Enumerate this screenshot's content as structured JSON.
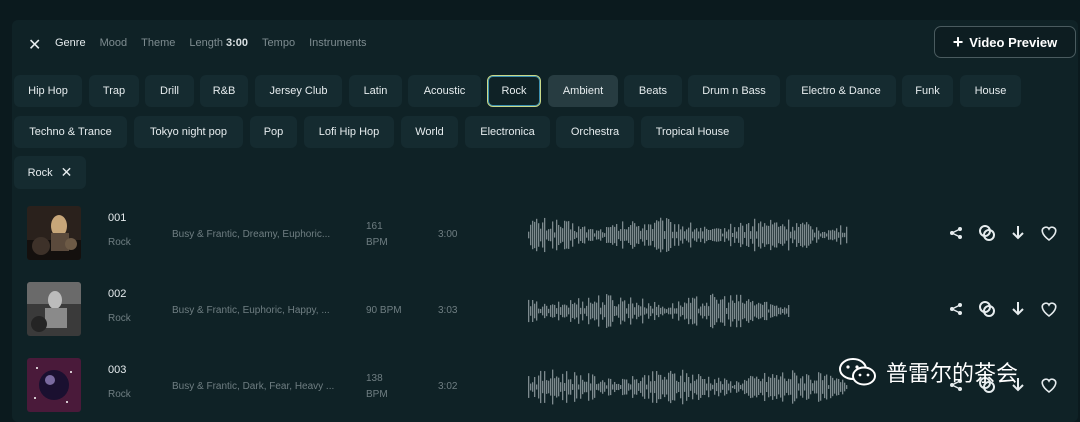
{
  "filters": {
    "close_label": "✕",
    "tabs": [
      "Genre",
      "Mood",
      "Theme",
      "Length",
      "Tempo",
      "Instruments"
    ],
    "length_value": "3:00"
  },
  "video_preview_label": "Video Preview",
  "genres_row1": [
    "Hip Hop",
    "Trap",
    "Drill",
    "R&B",
    "Jersey Club",
    "Latin",
    "Acoustic",
    "Rock",
    "Ambient",
    "Beats",
    "Drum n Bass",
    "Electro & Dance",
    "Funk",
    "House"
  ],
  "genres_row2": [
    "Techno & Trance",
    "Tokyo night pop",
    "Pop",
    "Lofi Hip Hop",
    "World",
    "Electronica",
    "Orchestra",
    "Tropical House"
  ],
  "selected_genre": "Rock",
  "active_tag": "Rock",
  "tracks": [
    {
      "number": "001",
      "genre": "Rock",
      "moods": "Busy & Frantic, Dreamy, Euphoric...",
      "bpm": "161",
      "bpm_unit": "BPM",
      "duration": "3:00"
    },
    {
      "number": "002",
      "genre": "Rock",
      "moods": "Busy & Frantic, Euphoric, Happy, ...",
      "bpm": "90 BPM",
      "bpm_unit": "",
      "duration": "3:03"
    },
    {
      "number": "003",
      "genre": "Rock",
      "moods": "Busy & Frantic, Dark, Fear, Heavy ...",
      "bpm": "138",
      "bpm_unit": "BPM",
      "duration": "3:02"
    }
  ],
  "watermark": "普雷尔的茶会",
  "colors": {
    "background": "#0b1a1e",
    "chip": "#152b30",
    "selected_border": "#c9d98a",
    "wave": "#7d8a8e"
  }
}
